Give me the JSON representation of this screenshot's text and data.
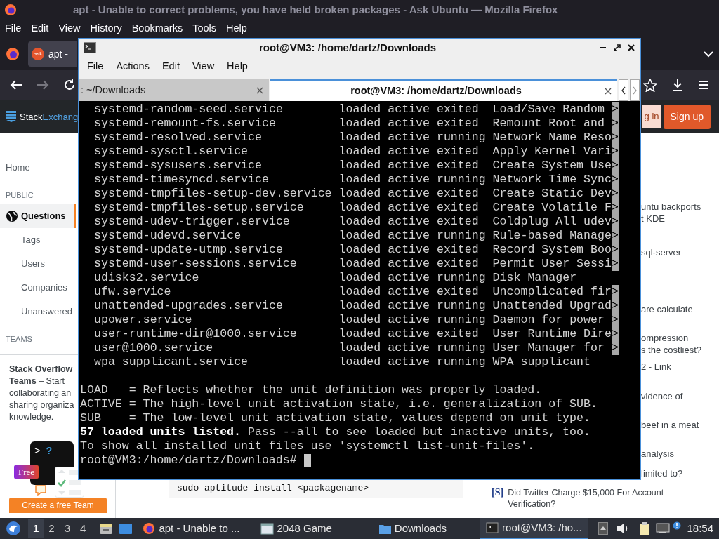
{
  "firefox": {
    "title": "apt - Unable to correct problems, you have held broken packages - Ask Ubuntu — Mozilla Firefox",
    "menu": [
      "File",
      "Edit",
      "View",
      "History",
      "Bookmarks",
      "Tools",
      "Help"
    ],
    "tab": {
      "favicon_text": "ask",
      "label": "apt -"
    },
    "site": {
      "logo_a": "Stack",
      "logo_b": "Exchang",
      "login": "g in",
      "signup": "Sign up",
      "nav": [
        {
          "kind": "top",
          "label": "Home",
          "selected": false
        },
        {
          "kind": "heading",
          "label": "PUBLIC"
        },
        {
          "kind": "top",
          "label": "Questions",
          "selected": true
        },
        {
          "kind": "sub",
          "label": "Tags",
          "selected": false
        },
        {
          "kind": "sub",
          "label": "Users",
          "selected": false
        },
        {
          "kind": "sub",
          "label": "Companies",
          "selected": false
        },
        {
          "kind": "sub",
          "label": "Unanswered",
          "selected": false
        },
        {
          "kind": "heading",
          "label": "TEAMS"
        }
      ],
      "teams_card": {
        "lines": [
          "**Stack Overflow**",
          "**Teams** – Start",
          "collaborating an",
          "sharing organiza",
          "knowledge."
        ],
        "prompt": ">_",
        "prompt_mark": "?",
        "badge": "Free",
        "button": "Create a free Team"
      },
      "code": "sudo aptitude install <packagename>",
      "hot": [
        [
          "untu backports",
          "t KDE"
        ],
        [
          "sql-server"
        ],
        [
          "are calculate"
        ],
        [
          "ompression",
          "s the costliest?"
        ],
        [
          "2 - Link"
        ],
        [
          "vidence of"
        ],
        [
          "beef in a meat"
        ],
        [
          "analysis"
        ],
        [
          "limited to?"
        ]
      ],
      "featured": {
        "mark": "[S]",
        "text": "Did Twitter Charge $15,000 For Account Verification?"
      }
    }
  },
  "terminal": {
    "title": "root@VM3: /home/dartz/Downloads",
    "menu": [
      "File",
      "Actions",
      "Edit",
      "View",
      "Help"
    ],
    "tabs": [
      {
        "label": ": ~/Downloads",
        "selected": false
      },
      {
        "label": "root@VM3: /home/dartz/Downloads",
        "selected": true
      }
    ],
    "units": [
      {
        "unit": "systemd-random-seed.service",
        "load": "loaded",
        "active": "active",
        "sub": "exited",
        "description": "Load/Save Random",
        "marker": ">"
      },
      {
        "unit": "systemd-remount-fs.service",
        "load": "loaded",
        "active": "active",
        "sub": "exited",
        "description": "Remount Root and",
        "marker": ">"
      },
      {
        "unit": "systemd-resolved.service",
        "load": "loaded",
        "active": "active",
        "sub": "running",
        "description": "Network Name Reso",
        "marker": ">"
      },
      {
        "unit": "systemd-sysctl.service",
        "load": "loaded",
        "active": "active",
        "sub": "exited",
        "description": "Apply Kernel Vari",
        "marker": ">"
      },
      {
        "unit": "systemd-sysusers.service",
        "load": "loaded",
        "active": "active",
        "sub": "exited",
        "description": "Create System Use",
        "marker": ">"
      },
      {
        "unit": "systemd-timesyncd.service",
        "load": "loaded",
        "active": "active",
        "sub": "running",
        "description": "Network Time Sync",
        "marker": ">"
      },
      {
        "unit": "systemd-tmpfiles-setup-dev.service",
        "load": "loaded",
        "active": "active",
        "sub": "exited",
        "description": "Create Static Dev",
        "marker": ">"
      },
      {
        "unit": "systemd-tmpfiles-setup.service",
        "load": "loaded",
        "active": "active",
        "sub": "exited",
        "description": "Create Volatile F",
        "marker": ">"
      },
      {
        "unit": "systemd-udev-trigger.service",
        "load": "loaded",
        "active": "active",
        "sub": "exited",
        "description": "Coldplug All udev",
        "marker": ">"
      },
      {
        "unit": "systemd-udevd.service",
        "load": "loaded",
        "active": "active",
        "sub": "running",
        "description": "Rule-based Manage",
        "marker": ">"
      },
      {
        "unit": "systemd-update-utmp.service",
        "load": "loaded",
        "active": "active",
        "sub": "exited",
        "description": "Record System Boo",
        "marker": ">"
      },
      {
        "unit": "systemd-user-sessions.service",
        "load": "loaded",
        "active": "active",
        "sub": "exited",
        "description": "Permit User Sessi",
        "marker": ">"
      },
      {
        "unit": "udisks2.service",
        "load": "loaded",
        "active": "active",
        "sub": "running",
        "description": "Disk Manager"
      },
      {
        "unit": "ufw.service",
        "load": "loaded",
        "active": "active",
        "sub": "exited",
        "description": "Uncomplicated fir",
        "marker": ">"
      },
      {
        "unit": "unattended-upgrades.service",
        "load": "loaded",
        "active": "active",
        "sub": "running",
        "description": "Unattended Upgrad",
        "marker": ">"
      },
      {
        "unit": "upower.service",
        "load": "loaded",
        "active": "active",
        "sub": "running",
        "description": "Daemon for power",
        "marker": ">"
      },
      {
        "unit": "user-runtime-dir@1000.service",
        "load": "loaded",
        "active": "active",
        "sub": "exited",
        "description": "User Runtime Dire",
        "marker": ">"
      },
      {
        "unit": "user@1000.service",
        "load": "loaded",
        "active": "active",
        "sub": "running",
        "description": "User Manager for",
        "marker": ">"
      },
      {
        "unit": "wpa_supplicant.service",
        "load": "loaded",
        "active": "active",
        "sub": "running",
        "description": "WPA supplicant"
      }
    ],
    "legend": [
      "LOAD   = Reflects whether the unit definition was properly loaded.",
      "ACTIVE = The high-level unit activation state, i.e. generalization of SUB.",
      "SUB    = The low-level unit activation state, values depend on unit type."
    ],
    "summary": "**57 loaded units listed.** Pass --all to see loaded but inactive units, too.",
    "hint": "To show all installed unit files use 'systemctl list-unit-files'.",
    "prompt": "root@VM3:/home/dartz/Downloads#"
  },
  "taskbar": {
    "workspaces": [
      {
        "label": "1",
        "selected": true
      },
      {
        "label": "2",
        "selected": false
      },
      {
        "label": "3",
        "selected": false
      },
      {
        "label": "4",
        "selected": false
      }
    ],
    "tasks": [
      {
        "kind": "browser",
        "label": "apt - Unable to ...",
        "selected": false
      },
      {
        "kind": "window",
        "label": "2048 Game",
        "selected": false
      },
      {
        "kind": "folder",
        "label": "Downloads",
        "selected": false
      },
      {
        "kind": "terminal",
        "label": "root@VM3: /ho...",
        "selected": true
      }
    ],
    "clock": "18:54"
  }
}
